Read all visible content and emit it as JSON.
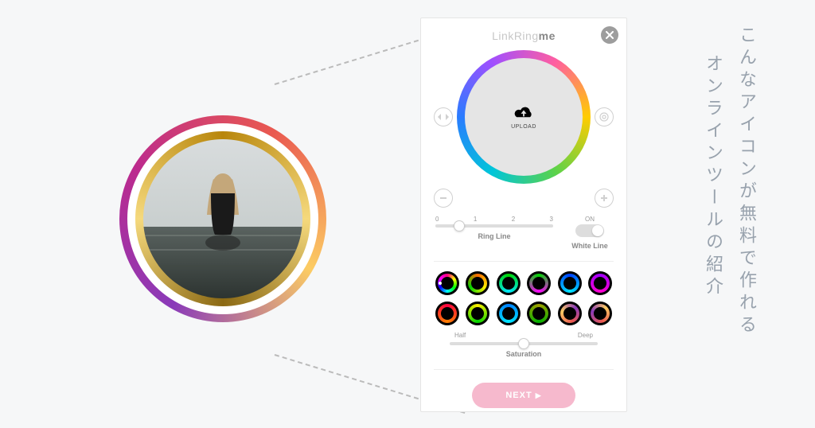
{
  "headline": {
    "line1": "こんなアイコンが無料で作れる",
    "line2": "オンラインツールの紹介"
  },
  "panel": {
    "logo_prefix": "LinkRing",
    "logo_suffix": "me",
    "upload_label": "UPLOAD",
    "ring_line": {
      "ticks": [
        "0",
        "1",
        "2",
        "3"
      ],
      "label": "Ring Line",
      "value_percent": 20
    },
    "white_line": {
      "on_label": "ON",
      "label": "White Line",
      "enabled": true
    },
    "saturation": {
      "left_label": "Half",
      "right_label": "Deep",
      "label": "Saturation",
      "value_percent": 50
    },
    "next_label": "NEXT"
  }
}
